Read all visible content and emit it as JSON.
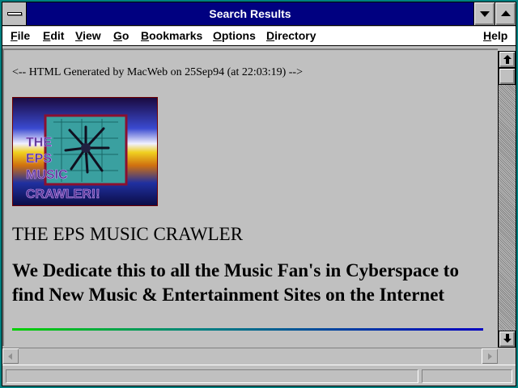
{
  "window": {
    "title": "Search Results"
  },
  "menu": {
    "file": "File",
    "edit": "Edit",
    "view": "View",
    "go": "Go",
    "bookmarks": "Bookmarks",
    "options": "Options",
    "directory": "Directory",
    "help": "Help"
  },
  "page": {
    "comment": "<-- HTML Generated by MacWeb on 25Sep94 (at 22:03:19) -->",
    "logo_text": "THE EPS MUSIC CRAWLER!!",
    "heading": "THE EPS MUSIC CRAWLER",
    "tagline": "We Dedicate this to all the Music Fan's in Cyberspace to find New Music & Entertainment Sites on the Internet"
  },
  "colors": {
    "title_bar": "#000080",
    "window_background": "#c0c0c0",
    "desktop": "#008080"
  },
  "icons": [
    "system-menu-icon",
    "minimize-icon",
    "maximize-icon",
    "scroll-up-icon",
    "scroll-down-icon",
    "scroll-left-icon",
    "scroll-right-icon"
  ]
}
